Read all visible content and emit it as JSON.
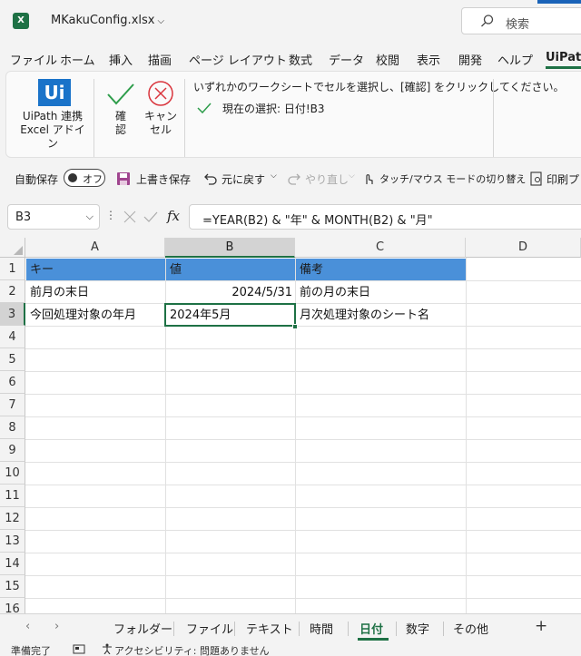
{
  "window": {
    "app_icon": "excel-icon",
    "file_name": "MKakuConfig.xlsx",
    "search_placeholder": "検索"
  },
  "menu": {
    "tabs": [
      "ファイル",
      "ホーム",
      "挿入",
      "描画",
      "ページ レイアウト",
      "数式",
      "データ",
      "校閲",
      "表示",
      "開発",
      "ヘルプ",
      "UiPath"
    ],
    "active": "UiPath"
  },
  "ribbon": {
    "addin_logo": "Ui",
    "addin_label_1": "UiPath 連携",
    "addin_label_2": "Excel アドイン",
    "confirm_label_1": "確",
    "confirm_label_2": "認",
    "cancel_label_1": "キャ",
    "cancel_label_2": "ン",
    "cancel_label_3": "セル",
    "instruction": "いずれかのワークシートでセルを選択し、[確認] をクリックしてください。",
    "current_selection": "現在の選択: 日付!B3"
  },
  "quick_access": {
    "autosave_label": "自動保存",
    "autosave_state": "オフ",
    "overwrite_save": "上書き保存",
    "undo": "元に戻す",
    "redo": "やり直し",
    "touch_mode": "タッチ/マウス モードの切り替え",
    "print": "印刷プ"
  },
  "formula_bar": {
    "name_box": "B3",
    "fx": "fx",
    "formula": "=YEAR(B2) & \"年\" & MONTH(B2) & \"月\""
  },
  "grid": {
    "columns": [
      "A",
      "B",
      "C",
      "D"
    ],
    "selected_column": "B",
    "rows": [
      "1",
      "2",
      "3",
      "4",
      "5",
      "6",
      "7",
      "8",
      "9",
      "10",
      "11",
      "12",
      "13",
      "14",
      "15",
      "16"
    ],
    "selected_row": "3",
    "cells": {
      "a1": "キー",
      "b1": "値",
      "c1": "備考",
      "a2": "前月の末日",
      "b2": "2024/5/31",
      "c2": "前の月の末日",
      "a3": "今回処理対象の年月",
      "b3": "2024年5月",
      "c3": "月次処理対象のシート名"
    }
  },
  "sheets": {
    "tabs": [
      "フォルダー",
      "ファイル",
      "テキスト",
      "時間",
      "日付",
      "数字",
      "その他"
    ],
    "active": "日付",
    "add_label": "+"
  },
  "status": {
    "ready": "準備完了",
    "accessibility": "アクセシビリティ: 問題ありません"
  },
  "colors": {
    "accent": "#1e7145",
    "header_fill": "#4a90d9",
    "uipath_blue": "#1a73c9",
    "cancel_red": "#d9343c",
    "confirm_green": "#2e9d4b"
  }
}
